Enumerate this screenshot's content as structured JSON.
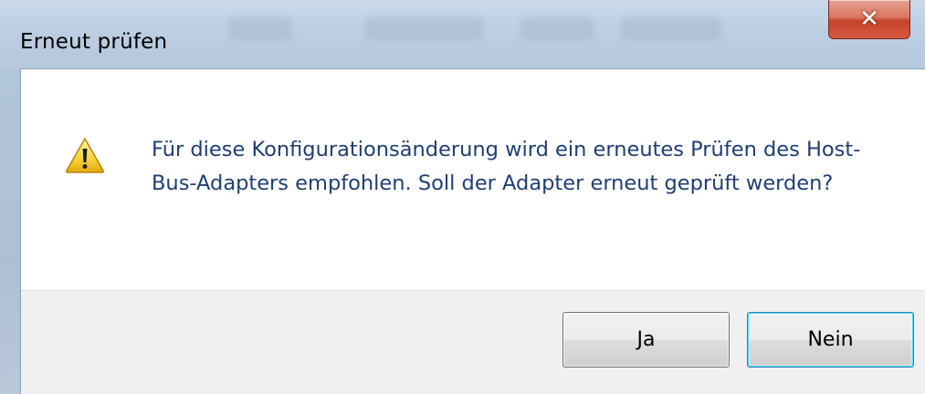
{
  "dialog": {
    "title": "Erneut prüfen",
    "close_icon": "close-icon",
    "message_icon": "warning-icon",
    "message": "Für diese Konfigurationsänderung wird ein erneutes Prüfen des Host-Bus-Adapters empfohlen. Soll der Adapter erneut geprüft werden?",
    "buttons": {
      "yes_label": "Ja",
      "no_label": "Nein"
    }
  }
}
